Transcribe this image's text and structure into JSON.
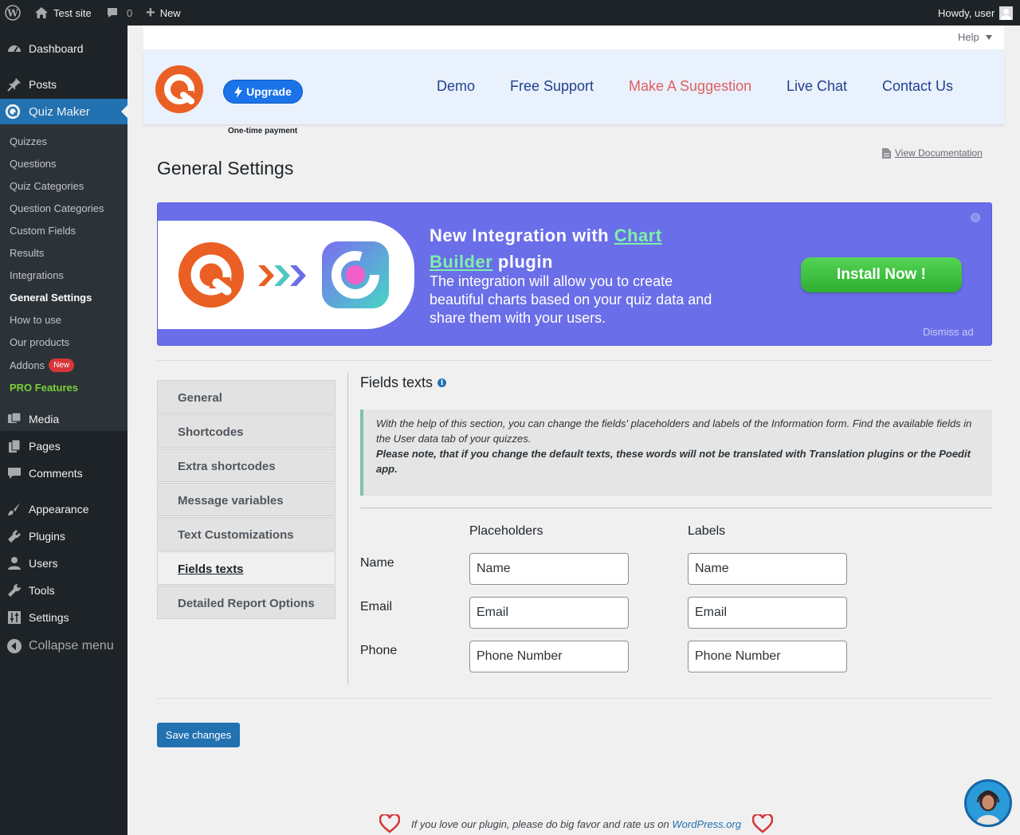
{
  "adminbar": {
    "site": "Test site",
    "comments": "0",
    "new": "New",
    "howdy": "Howdy, user"
  },
  "menu": {
    "dashboard": "Dashboard",
    "posts": "Posts",
    "quiz_maker": "Quiz Maker",
    "sub": [
      "Quizzes",
      "Questions",
      "Quiz Categories",
      "Question Categories",
      "Custom Fields",
      "Results",
      "Integrations",
      "General Settings",
      "How to use",
      "Our products",
      "Addons",
      "PRO Features"
    ],
    "addons_badge": "New",
    "media": "Media",
    "pages": "Pages",
    "comments": "Comments",
    "appearance": "Appearance",
    "plugins": "Plugins",
    "users": "Users",
    "tools": "Tools",
    "settings": "Settings",
    "collapse": "Collapse menu"
  },
  "help": "Help",
  "topnav": {
    "upgrade": "Upgrade",
    "one_time": "One-time payment",
    "links": [
      "Demo",
      "Free Support",
      "Make A Suggestion",
      "Live Chat",
      "Contact Us"
    ]
  },
  "page_title": "General Settings",
  "view_doc": "View Documentation",
  "banner": {
    "title_pre": "New Integration with ",
    "title_link": "Chart Builder",
    "title_post": " plugin",
    "desc": "The integration will allow you to create beautiful charts based on your quiz data and share them with your users.",
    "install": "Install Now !",
    "dismiss": "Dismiss ad"
  },
  "tabs": [
    "General",
    "Shortcodes",
    "Extra shortcodes",
    "Message variables",
    "Text Customizations",
    "Fields texts",
    "Detailed Report Options"
  ],
  "section": {
    "title": "Fields texts",
    "note1": "With the help of this section, you can change the fields' placeholders and labels of the Information form. Find the available fields in the User data tab of your quizzes.",
    "note2": "Please note, that if you change the default texts, these words will not be translated with Translation plugins or the Poedit app.",
    "col_placeholders": "Placeholders",
    "col_labels": "Labels",
    "rows": [
      {
        "label": "Name",
        "placeholder": "Name",
        "field_label": "Name"
      },
      {
        "label": "Email",
        "placeholder": "Email",
        "field_label": "Email"
      },
      {
        "label": "Phone",
        "placeholder": "Phone Number",
        "field_label": "Phone Number"
      }
    ]
  },
  "save": "Save changes",
  "footer": {
    "text": "If you love our plugin, please do big favor and rate us on ",
    "link": "WordPress.org"
  },
  "colors": {
    "accent": "#2271b1",
    "brand": "#ea5f23",
    "banner": "#6a6ee8",
    "install": "#3fbe3f",
    "suggestion": "#e05f5f"
  }
}
